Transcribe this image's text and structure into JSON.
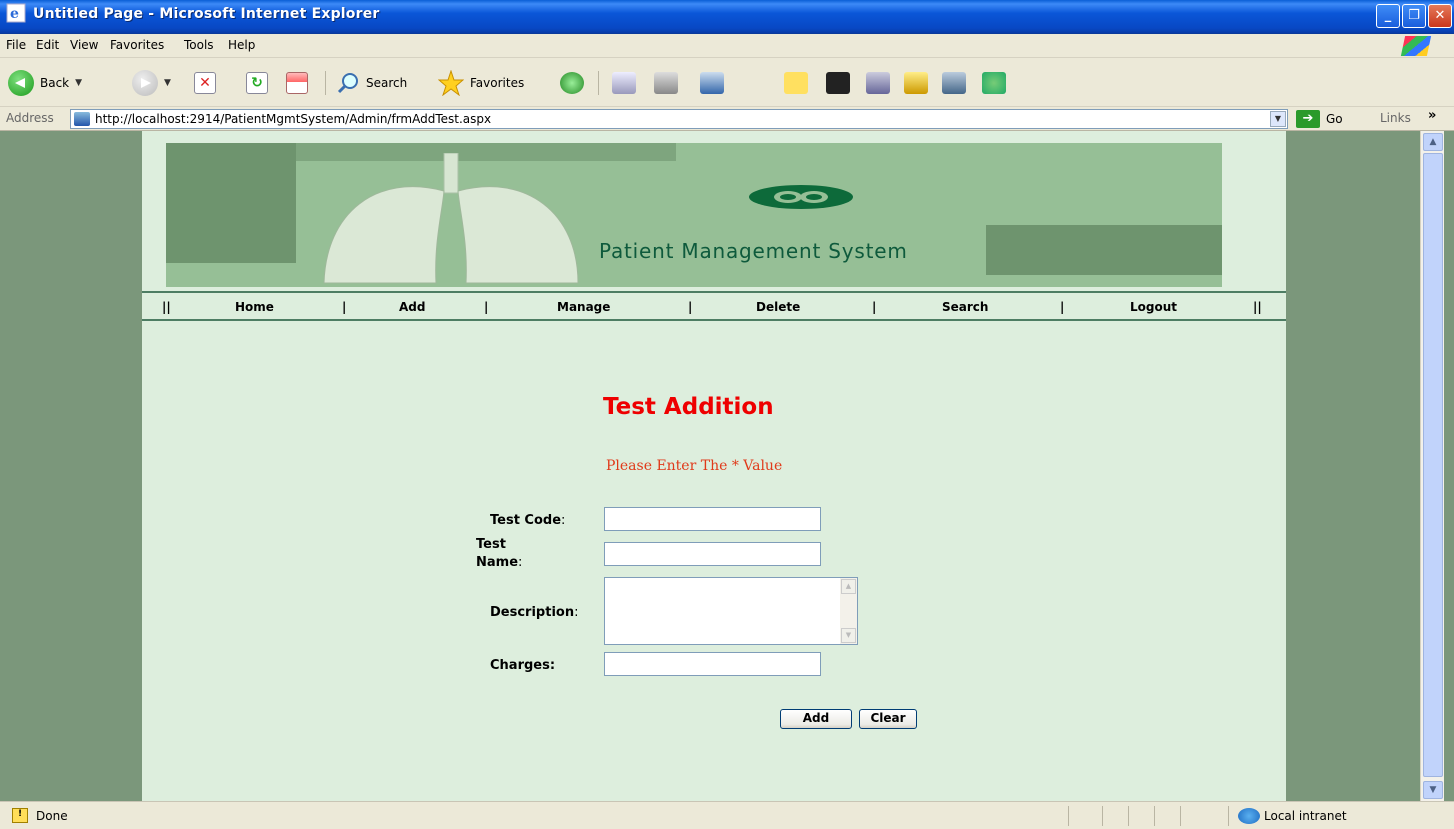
{
  "window": {
    "title": "Untitled Page - Microsoft Internet Explorer",
    "min_glyph": "_",
    "max_glyph": "❐",
    "close_glyph": "✕"
  },
  "menu": [
    "File",
    "Edit",
    "View",
    "Favorites",
    "Tools",
    "Help"
  ],
  "toolbar": {
    "back_label": "Back",
    "search_label": "Search",
    "favorites_label": "Favorites",
    "stop_glyph": "✕",
    "refresh_glyph": "↻"
  },
  "address": {
    "label": "Address",
    "url": "http://localhost:2914/PatientMgmtSystem/Admin/frmAddTest.aspx",
    "go_label": "Go",
    "links_label": "Links",
    "links_more": "»"
  },
  "banner": {
    "title": "Patient Management System"
  },
  "nav": {
    "separators": [
      "||",
      "|",
      "|",
      "|",
      "|",
      "|",
      "||"
    ],
    "items": [
      "Home",
      "Add",
      "Manage",
      "Delete",
      "Search",
      "Logout"
    ]
  },
  "form": {
    "heading": "Test Addition",
    "notice": "Please Enter The * Value",
    "fields": {
      "test_code_label": "Test Code",
      "test_name_label_line1": "Test",
      "test_name_label_line2": "Name",
      "description_label": "Description",
      "charges_label": "Charges:",
      "colon": ":"
    },
    "values": {
      "test_code": "",
      "test_name": "",
      "description": "",
      "charges": ""
    },
    "buttons": {
      "add": "Add",
      "clear": "Clear"
    }
  },
  "status": {
    "text": "Done",
    "zone": "Local intranet"
  },
  "colors": {
    "heading": "#ee0000",
    "notice": "#e03a1a",
    "page_bg": "#ddeedd",
    "outer_bg": "#7b977b"
  }
}
